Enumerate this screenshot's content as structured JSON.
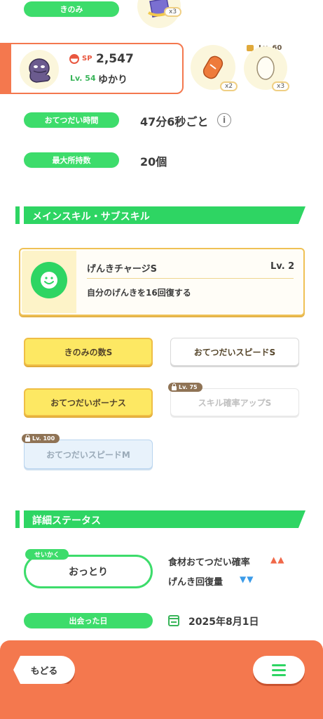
{
  "top_row": {
    "label": "きのみ",
    "item_qty": "x3"
  },
  "pokemon_card": {
    "sp_label": "SP",
    "sp_value": "2,547",
    "level": "Lv. 54",
    "name": "ゆかり",
    "items": [
      {
        "qty": "x2"
      },
      {
        "qty": "x3",
        "unlock_level": "Lv. 60"
      }
    ]
  },
  "stats": {
    "help_time_label": "おてつだい時間",
    "help_time_value": "47分6秒ごと",
    "max_carry_label": "最大所持数",
    "max_carry_value": "20個"
  },
  "skills_section": {
    "title": "メインスキル・サブスキル",
    "main_skill": {
      "name": "げんきチャージS",
      "level": "Lv. 2",
      "description": "自分のげんきを16回復する"
    },
    "sub_skills": [
      {
        "label": "きのみの数S",
        "style": "yellow"
      },
      {
        "label": "おてつだいスピードS",
        "style": "white"
      },
      {
        "label": "おてつだいボーナス",
        "style": "yellow"
      },
      {
        "label": "スキル確率アップS",
        "style": "disabled",
        "unlock_level": "Lv. 75"
      },
      {
        "label": "おてつだいスピードM",
        "style": "blue",
        "unlock_level": "Lv. 100"
      }
    ]
  },
  "details_section": {
    "title": "詳細ステータス",
    "nature_tag": "せいかく",
    "nature_value": "おっとり",
    "nature_up": "食材おてつだい確率",
    "nature_down": "げんき回復量",
    "met_date_label": "出会った日",
    "met_date_value": "2025年8月1日"
  },
  "footer": {
    "back_label": "もどる"
  },
  "colors": {
    "accent_green": "#3ddc6b",
    "footer_orange": "#f4784e",
    "up_red": "#f0694a",
    "down_blue": "#3b9be8"
  }
}
